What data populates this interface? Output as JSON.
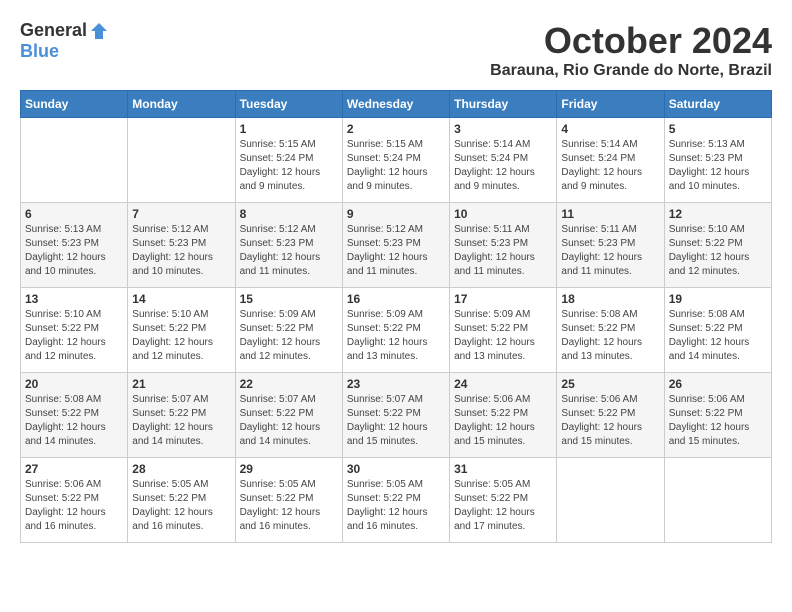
{
  "logo": {
    "general": "General",
    "blue": "Blue"
  },
  "title": {
    "month": "October 2024",
    "location": "Barauna, Rio Grande do Norte, Brazil"
  },
  "weekdays": [
    "Sunday",
    "Monday",
    "Tuesday",
    "Wednesday",
    "Thursday",
    "Friday",
    "Saturday"
  ],
  "weeks": [
    [
      {
        "day": null,
        "info": null
      },
      {
        "day": null,
        "info": null
      },
      {
        "day": "1",
        "info": "Sunrise: 5:15 AM\nSunset: 5:24 PM\nDaylight: 12 hours and 9 minutes."
      },
      {
        "day": "2",
        "info": "Sunrise: 5:15 AM\nSunset: 5:24 PM\nDaylight: 12 hours and 9 minutes."
      },
      {
        "day": "3",
        "info": "Sunrise: 5:14 AM\nSunset: 5:24 PM\nDaylight: 12 hours and 9 minutes."
      },
      {
        "day": "4",
        "info": "Sunrise: 5:14 AM\nSunset: 5:24 PM\nDaylight: 12 hours and 9 minutes."
      },
      {
        "day": "5",
        "info": "Sunrise: 5:13 AM\nSunset: 5:23 PM\nDaylight: 12 hours and 10 minutes."
      }
    ],
    [
      {
        "day": "6",
        "info": "Sunrise: 5:13 AM\nSunset: 5:23 PM\nDaylight: 12 hours and 10 minutes."
      },
      {
        "day": "7",
        "info": "Sunrise: 5:12 AM\nSunset: 5:23 PM\nDaylight: 12 hours and 10 minutes."
      },
      {
        "day": "8",
        "info": "Sunrise: 5:12 AM\nSunset: 5:23 PM\nDaylight: 12 hours and 11 minutes."
      },
      {
        "day": "9",
        "info": "Sunrise: 5:12 AM\nSunset: 5:23 PM\nDaylight: 12 hours and 11 minutes."
      },
      {
        "day": "10",
        "info": "Sunrise: 5:11 AM\nSunset: 5:23 PM\nDaylight: 12 hours and 11 minutes."
      },
      {
        "day": "11",
        "info": "Sunrise: 5:11 AM\nSunset: 5:23 PM\nDaylight: 12 hours and 11 minutes."
      },
      {
        "day": "12",
        "info": "Sunrise: 5:10 AM\nSunset: 5:22 PM\nDaylight: 12 hours and 12 minutes."
      }
    ],
    [
      {
        "day": "13",
        "info": "Sunrise: 5:10 AM\nSunset: 5:22 PM\nDaylight: 12 hours and 12 minutes."
      },
      {
        "day": "14",
        "info": "Sunrise: 5:10 AM\nSunset: 5:22 PM\nDaylight: 12 hours and 12 minutes."
      },
      {
        "day": "15",
        "info": "Sunrise: 5:09 AM\nSunset: 5:22 PM\nDaylight: 12 hours and 12 minutes."
      },
      {
        "day": "16",
        "info": "Sunrise: 5:09 AM\nSunset: 5:22 PM\nDaylight: 12 hours and 13 minutes."
      },
      {
        "day": "17",
        "info": "Sunrise: 5:09 AM\nSunset: 5:22 PM\nDaylight: 12 hours and 13 minutes."
      },
      {
        "day": "18",
        "info": "Sunrise: 5:08 AM\nSunset: 5:22 PM\nDaylight: 12 hours and 13 minutes."
      },
      {
        "day": "19",
        "info": "Sunrise: 5:08 AM\nSunset: 5:22 PM\nDaylight: 12 hours and 14 minutes."
      }
    ],
    [
      {
        "day": "20",
        "info": "Sunrise: 5:08 AM\nSunset: 5:22 PM\nDaylight: 12 hours and 14 minutes."
      },
      {
        "day": "21",
        "info": "Sunrise: 5:07 AM\nSunset: 5:22 PM\nDaylight: 12 hours and 14 minutes."
      },
      {
        "day": "22",
        "info": "Sunrise: 5:07 AM\nSunset: 5:22 PM\nDaylight: 12 hours and 14 minutes."
      },
      {
        "day": "23",
        "info": "Sunrise: 5:07 AM\nSunset: 5:22 PM\nDaylight: 12 hours and 15 minutes."
      },
      {
        "day": "24",
        "info": "Sunrise: 5:06 AM\nSunset: 5:22 PM\nDaylight: 12 hours and 15 minutes."
      },
      {
        "day": "25",
        "info": "Sunrise: 5:06 AM\nSunset: 5:22 PM\nDaylight: 12 hours and 15 minutes."
      },
      {
        "day": "26",
        "info": "Sunrise: 5:06 AM\nSunset: 5:22 PM\nDaylight: 12 hours and 15 minutes."
      }
    ],
    [
      {
        "day": "27",
        "info": "Sunrise: 5:06 AM\nSunset: 5:22 PM\nDaylight: 12 hours and 16 minutes."
      },
      {
        "day": "28",
        "info": "Sunrise: 5:05 AM\nSunset: 5:22 PM\nDaylight: 12 hours and 16 minutes."
      },
      {
        "day": "29",
        "info": "Sunrise: 5:05 AM\nSunset: 5:22 PM\nDaylight: 12 hours and 16 minutes."
      },
      {
        "day": "30",
        "info": "Sunrise: 5:05 AM\nSunset: 5:22 PM\nDaylight: 12 hours and 16 minutes."
      },
      {
        "day": "31",
        "info": "Sunrise: 5:05 AM\nSunset: 5:22 PM\nDaylight: 12 hours and 17 minutes."
      },
      {
        "day": null,
        "info": null
      },
      {
        "day": null,
        "info": null
      }
    ]
  ]
}
